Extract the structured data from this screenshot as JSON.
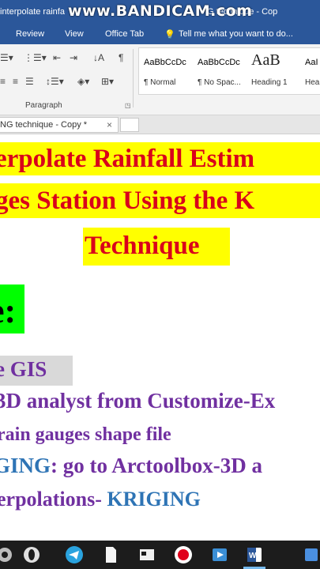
{
  "window": {
    "title_left": "interpolate rainfa",
    "watermark": "www.BANDICAM.com",
    "title_right": "G technique - Cop"
  },
  "ribbon_tabs": [
    "Review",
    "View",
    "Office Tab"
  ],
  "tell_me": "Tell me what you want to do...",
  "ribbon": {
    "paragraph_label": "Paragraph",
    "styles": [
      {
        "sample": "AaBbCcDc",
        "name": "¶ Normal"
      },
      {
        "sample": "AaBbCcDc",
        "name": "¶ No Spac..."
      },
      {
        "sample": "AaB",
        "name": "Heading 1"
      },
      {
        "sample": "AaI",
        "name": "Hea"
      }
    ]
  },
  "doc_tab": {
    "label": "NG technique - Copy *",
    "close": "×"
  },
  "document": {
    "title_line1": "erpolate Rainfall Estim",
    "title_line2": "ges Station Using the K",
    "title_line3": "Technique",
    "green_heading": "e:",
    "section_heading": "e GIS",
    "line1": "3D analyst from Customize-Ex",
    "line2": "rain gauges shape file",
    "line3_prefix": "GING",
    "line3_rest": ": go to Arctoolbox-3D a",
    "line4_prefix": "erpolations- ",
    "line4_keyword": "KRIGING"
  },
  "colors": {
    "titlebar": "#2b579a",
    "highlight_yellow": "#ffff00",
    "title_red": "#d9001b",
    "highlight_green": "#00ff00",
    "purple_text": "#7030a0",
    "blue_text": "#2e74b5"
  }
}
